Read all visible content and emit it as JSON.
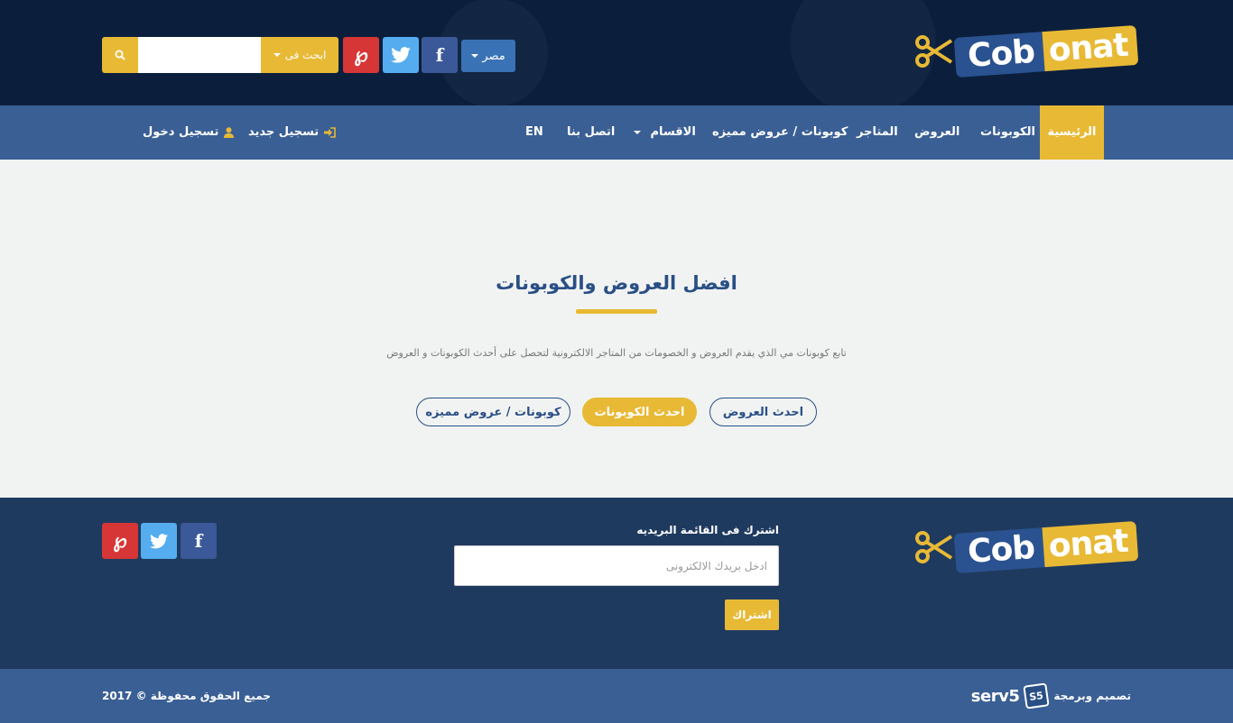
{
  "header": {
    "logo": {
      "part1": "Cob",
      "part2": "onat"
    },
    "country_label": "مصر",
    "search": {
      "dropdown_label": "ابحث فى",
      "placeholder": ""
    },
    "social": [
      "facebook-icon",
      "twitter-icon",
      "pinterest-icon"
    ]
  },
  "nav": {
    "items": [
      {
        "label": "الرئيسية",
        "active": true
      },
      {
        "label": "الكوبونات"
      },
      {
        "label": "العروض"
      },
      {
        "label": "المتاجر"
      },
      {
        "label": "كوبونات / عروض مميزه"
      },
      {
        "label": "الاقسام",
        "dropdown": true
      },
      {
        "label": "اتصل بنا"
      },
      {
        "label": "EN"
      }
    ],
    "register": "تسجيل جديد",
    "login": "تسجيل دخول"
  },
  "hero": {
    "title": "افضل العروض والكوبونات",
    "description": "تابع كوبونات مي الذي يقدم العروض و الخصومات من المتاجر الالكترونية لتحصل على أحدث الكوبونات و العروض",
    "buttons": {
      "latest_offers": "احدث العروض",
      "latest_coupons": "احدث الكوبونات",
      "featured": "كوبونات / عروض مميزه"
    }
  },
  "footer": {
    "newsletter_title": "اشترك فى القائمة البريديه",
    "email_placeholder": "ادخل بريدك الالكترونى",
    "subscribe": "اشتراك",
    "copyright": "جميع الحقوق محفوظة © 2017",
    "credit_label": "تصميم وبرمجة",
    "credit_brand": "serv5"
  },
  "colors": {
    "dark_navy": "#0b1f3d",
    "nav_blue": "#3a5f95",
    "accent_yellow": "#e8b935",
    "heading_blue": "#2a4f85",
    "footer_navy": "#1f3a5f"
  }
}
